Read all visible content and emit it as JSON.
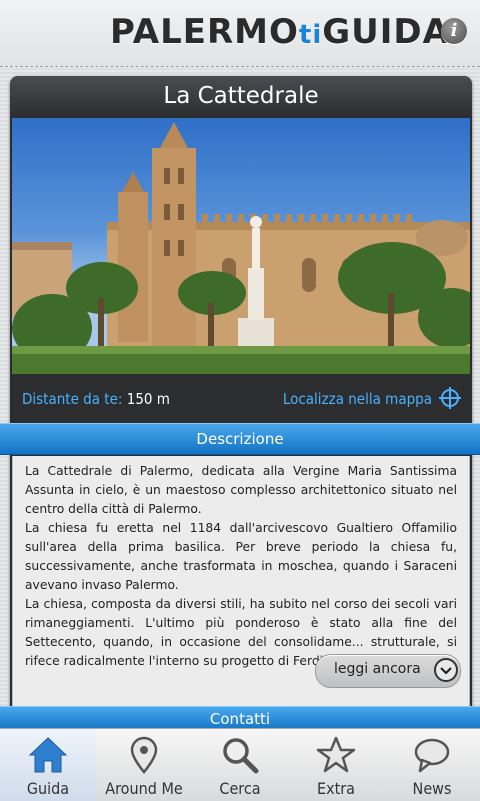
{
  "app": {
    "logo_main": "PALERMO",
    "logo_ti": "ti",
    "logo_end": "GUIDA",
    "info_glyph": "i"
  },
  "detail": {
    "title": "La Cattedrale",
    "distance_label": "Distante da te:",
    "distance_value": "150 m",
    "map_link": "Localizza nella mappa"
  },
  "description": {
    "section_title": "Descrizione",
    "paragraphs": [
      "La Cattedrale di Palermo, dedicata alla Vergine Maria Santissima Assunta in cielo, è un maestoso complesso architettonico situato nel centro della città di Palermo.",
      "La chiesa fu eretta nel 1184 dall'arcivescovo Gualtiero Offamilio sull'area della prima basilica. Per breve periodo la chiesa fu, successivamente, anche trasformata in moschea, quando i Saraceni avevano invaso Palermo.",
      "La chiesa, composta da diversi stili, ha subito nel corso dei secoli vari rimaneggiamenti. L'ultimo più ponderoso è stato alla fine del Settecento, quando, in occasione del consolidame... strutturale, si rifece radicalmente l'interno su progetto di Ferdinando Fuga."
    ],
    "read_more": "leggi ancora"
  },
  "contacts": {
    "section_title": "Contatti"
  },
  "tabs": [
    {
      "label": "Guida",
      "icon": "home-icon",
      "active": true
    },
    {
      "label": "Around Me",
      "icon": "map-pin-icon",
      "active": false
    },
    {
      "label": "Cerca",
      "icon": "search-icon",
      "active": false
    },
    {
      "label": "Extra",
      "icon": "star-icon",
      "active": false
    },
    {
      "label": "News",
      "icon": "speech-bubble-icon",
      "active": false
    }
  ],
  "colors": {
    "accent": "#1a84d6",
    "link": "#4ab1ff",
    "section_bar": "#1b7fd0"
  }
}
